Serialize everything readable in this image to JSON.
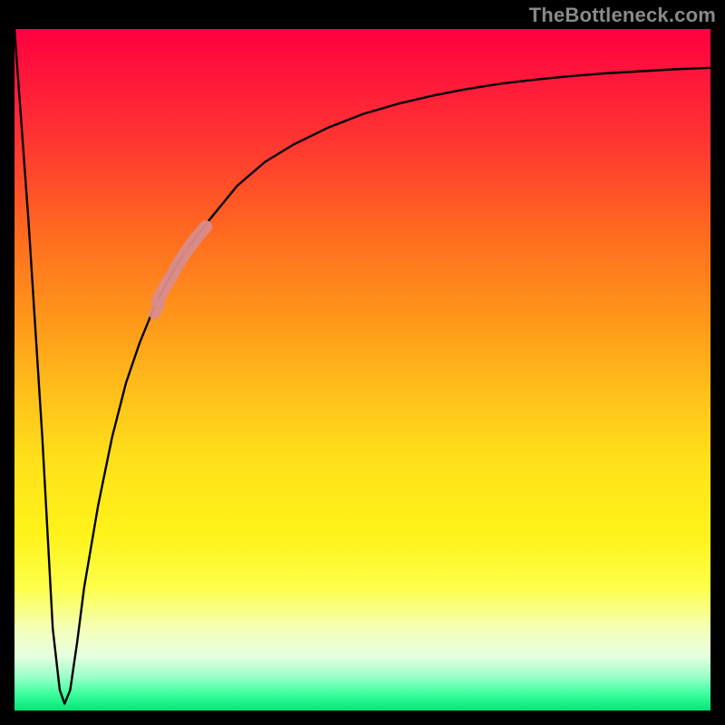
{
  "attribution": "TheBottleneck.com",
  "chart_data": {
    "type": "line",
    "title": "",
    "xlabel": "",
    "ylabel": "",
    "xlim": [
      0,
      100
    ],
    "ylim": [
      0,
      100
    ],
    "series": [
      {
        "name": "bottleneck-curve",
        "color": "#000000",
        "x": [
          0,
          2,
          4,
          5.5,
          6.5,
          7.2,
          8,
          9,
          10,
          12,
          14,
          16,
          18,
          20,
          22.5,
          25,
          28,
          32,
          36,
          40,
          45,
          50,
          55,
          60,
          65,
          70,
          75,
          80,
          85,
          90,
          95,
          100
        ],
        "y": [
          100,
          72,
          40,
          12,
          3,
          1,
          3,
          10,
          18,
          30,
          40,
          48,
          54,
          59,
          64,
          68,
          72,
          77,
          80.5,
          83,
          85.5,
          87.5,
          89,
          90.2,
          91.2,
          92,
          92.6,
          93.1,
          93.5,
          93.8,
          94.1,
          94.3
        ]
      }
    ],
    "highlight": {
      "name": "highlight-segment",
      "color": "#d98c8c",
      "x": [
        20.5,
        21.0,
        21.8,
        22.8,
        23.0,
        23.5,
        24.0,
        24.5,
        25.0,
        25.5,
        26.0,
        26.5,
        27.0,
        27.5
      ],
      "y": [
        60.0,
        61.0,
        62.5,
        64.2,
        64.6,
        65.5,
        66.3,
        67.1,
        67.8,
        68.5,
        69.2,
        69.8,
        70.4,
        71.0
      ]
    },
    "background_gradient_stops": [
      {
        "pct": 0,
        "color": "#ff0040"
      },
      {
        "pct": 8,
        "color": "#ff1a3a"
      },
      {
        "pct": 18,
        "color": "#ff3b2f"
      },
      {
        "pct": 30,
        "color": "#ff6a1f"
      },
      {
        "pct": 42,
        "color": "#ff951a"
      },
      {
        "pct": 54,
        "color": "#ffc21a"
      },
      {
        "pct": 64,
        "color": "#ffe21a"
      },
      {
        "pct": 74,
        "color": "#fff21a"
      },
      {
        "pct": 82,
        "color": "#fdff4a"
      },
      {
        "pct": 88,
        "color": "#f4ffb8"
      },
      {
        "pct": 92,
        "color": "#e6ffe0"
      },
      {
        "pct": 95,
        "color": "#9cffc9"
      },
      {
        "pct": 97.5,
        "color": "#40ffa0"
      },
      {
        "pct": 100,
        "color": "#00e676"
      }
    ]
  }
}
